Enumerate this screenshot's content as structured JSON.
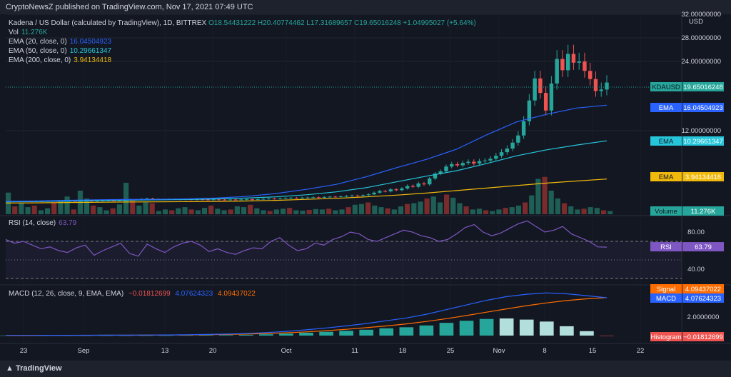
{
  "header": {
    "text": "CryptoNewsZ published on TradingView.com, Nov 17, 2021 07:49 UTC"
  },
  "footer": {
    "brand": "TradingView"
  },
  "legend": {
    "symbol": "Kadena / US Dollar (calculated by TradingView), 1D, BITTREX",
    "ohlc": "O18.54431222  H20.40774462  L17.31689657  C19.65016248  +1.04995027 (+5.64%)",
    "vol_label": "Vol",
    "vol_value": "11.276K",
    "ema20_label": "EMA (20, close, 0)",
    "ema20_value": "16.04504923",
    "ema50_label": "EMA (50, close, 0)",
    "ema50_value": "10.29661347",
    "ema200_label": "EMA (200, close, 0)",
    "ema200_value": "3.94134418",
    "rsi_label": "RSI (14, close)",
    "rsi_value": "63.79",
    "macd_label": "MACD (12, 26, close, 9, EMA, EMA)",
    "macd_hist": "−0.01812699",
    "macd_macd": "4.07624323",
    "macd_signal": "4.09437022"
  },
  "colors": {
    "up": "#26a69a",
    "down": "#ef5350",
    "ema20": "#2962ff",
    "ema50": "#26c6da",
    "ema200": "#f0b90b",
    "rsi": "#7e57c2",
    "macd": "#2962ff",
    "signal": "#ff6d00"
  },
  "chart_data": {
    "type": "candlestick",
    "price_axis": {
      "ticks": [
        "32.00000000",
        "28.00000000",
        "24.00000000",
        "12.00000000"
      ],
      "unit": "USD"
    },
    "rsi_axis": {
      "ticks": [
        "80.00",
        "40.00"
      ]
    },
    "macd_axis": {
      "ticks": [
        "2.0000000"
      ]
    },
    "x_ticks": [
      "23",
      "Sep",
      "13",
      "20",
      "Oct",
      "11",
      "18",
      "25",
      "Nov",
      "8",
      "15",
      "22"
    ],
    "tags": {
      "price": {
        "label": "KDAUSD",
        "value": "19.65016248"
      },
      "ema20": {
        "label": "EMA",
        "value": "16.04504923"
      },
      "ema50": {
        "label": "EMA",
        "value": "10.29661347"
      },
      "ema200": {
        "label": "EMA",
        "value": "3.94134418"
      },
      "volume": {
        "label": "Volume",
        "value": "11.276K"
      },
      "rsi": {
        "label": "RSI",
        "value": "63.79"
      },
      "signal": {
        "label": "Signal",
        "value": "4.09437022"
      },
      "macd": {
        "label": "MACD",
        "value": "4.07624323"
      },
      "histogram": {
        "label": "Histogram",
        "value": "−0.01812699"
      }
    },
    "candles": [
      [
        1.25,
        1.25
      ],
      [
        1.25,
        1.26
      ],
      [
        1.26,
        1.24
      ],
      [
        1.24,
        1.27
      ],
      [
        1.27,
        1.26
      ],
      [
        1.26,
        1.28
      ],
      [
        1.28,
        1.27
      ],
      [
        1.27,
        1.29
      ],
      [
        1.29,
        1.3
      ],
      [
        1.3,
        1.28
      ],
      [
        1.28,
        1.3
      ],
      [
        1.3,
        1.31
      ],
      [
        1.31,
        1.29
      ],
      [
        1.29,
        1.32
      ],
      [
        1.32,
        1.33
      ],
      [
        1.33,
        1.3
      ],
      [
        1.3,
        1.32
      ],
      [
        1.32,
        1.34
      ],
      [
        1.34,
        1.36
      ],
      [
        1.36,
        1.33
      ],
      [
        1.33,
        1.38
      ],
      [
        1.38,
        1.42
      ],
      [
        1.42,
        1.48
      ],
      [
        1.48,
        1.45
      ],
      [
        1.45,
        1.55
      ],
      [
        1.55,
        1.6
      ],
      [
        1.6,
        1.55
      ],
      [
        1.55,
        1.5
      ],
      [
        1.5,
        1.48
      ],
      [
        1.48,
        1.52
      ],
      [
        1.52,
        1.5
      ],
      [
        1.5,
        1.48
      ],
      [
        1.48,
        1.5
      ],
      [
        1.5,
        1.47
      ],
      [
        1.47,
        1.49
      ],
      [
        1.49,
        1.47
      ],
      [
        1.47,
        1.46
      ],
      [
        1.46,
        1.48
      ],
      [
        1.48,
        1.46
      ],
      [
        1.46,
        1.45
      ],
      [
        1.45,
        1.47
      ],
      [
        1.47,
        1.45
      ],
      [
        1.45,
        1.48
      ],
      [
        1.48,
        1.5
      ],
      [
        1.5,
        1.47
      ],
      [
        1.47,
        1.52
      ],
      [
        1.52,
        1.55
      ],
      [
        1.55,
        1.58
      ],
      [
        1.58,
        1.56
      ],
      [
        1.56,
        1.62
      ],
      [
        1.62,
        1.65
      ],
      [
        1.65,
        1.68
      ],
      [
        1.68,
        1.66
      ],
      [
        1.66,
        1.7
      ],
      [
        1.7,
        1.72
      ],
      [
        1.72,
        1.75
      ],
      [
        1.75,
        1.73
      ],
      [
        1.73,
        1.78
      ],
      [
        1.78,
        1.82
      ],
      [
        1.82,
        1.8
      ],
      [
        1.8,
        1.85
      ],
      [
        1.85,
        1.9
      ],
      [
        1.9,
        1.95
      ],
      [
        1.95,
        1.92
      ],
      [
        1.92,
        2.0
      ],
      [
        2.0,
        2.1
      ],
      [
        2.1,
        2.3
      ],
      [
        2.3,
        2.5
      ],
      [
        2.5,
        2.45
      ],
      [
        2.45,
        2.7
      ],
      [
        2.7,
        2.6
      ],
      [
        2.6,
        2.8
      ],
      [
        2.8,
        3.1
      ],
      [
        3.1,
        3.0
      ],
      [
        3.0,
        3.4
      ],
      [
        3.4,
        3.3
      ],
      [
        3.3,
        4.0
      ],
      [
        4.0,
        4.8
      ],
      [
        4.8,
        5.2
      ],
      [
        5.2,
        6.0
      ],
      [
        6.0,
        6.4
      ],
      [
        6.4,
        6.2
      ],
      [
        6.2,
        6.6
      ],
      [
        6.6,
        6.8
      ],
      [
        6.8,
        6.5
      ],
      [
        6.5,
        6.9
      ],
      [
        6.9,
        7.0
      ],
      [
        7.0,
        7.3
      ],
      [
        7.3,
        7.8
      ],
      [
        7.8,
        8.4
      ],
      [
        8.4,
        9.0
      ],
      [
        9.0,
        10.0
      ],
      [
        10.0,
        11.2
      ],
      [
        11.2,
        13.5
      ],
      [
        13.5,
        16.8
      ],
      [
        16.8,
        20.3
      ],
      [
        20.3,
        18.0
      ],
      [
        18.0,
        15.2
      ],
      [
        15.2,
        19.5
      ],
      [
        19.5,
        23.4
      ],
      [
        23.4,
        21.6
      ],
      [
        21.6,
        24.2
      ],
      [
        24.2,
        22.8
      ],
      [
        22.8,
        23.0
      ],
      [
        23.0,
        21.5
      ],
      [
        21.5,
        20.2
      ],
      [
        20.2,
        18.3
      ],
      [
        18.3,
        18.54
      ],
      [
        18.54,
        19.65
      ]
    ],
    "ema20": [
      1.25,
      1.3,
      1.38,
      1.45,
      1.48,
      1.5,
      1.55,
      1.65,
      1.85,
      2.2,
      2.7,
      3.3,
      4.3,
      5.8,
      7.2,
      8.9,
      11.3,
      13.4,
      14.6,
      15.6,
      16.05
    ],
    "ema50": [
      1.2,
      1.25,
      1.3,
      1.35,
      1.4,
      1.44,
      1.48,
      1.55,
      1.65,
      1.8,
      2.05,
      2.4,
      2.9,
      3.6,
      4.4,
      5.3,
      6.5,
      7.8,
      8.8,
      9.6,
      10.3
    ],
    "ema200": [
      1.05,
      1.08,
      1.12,
      1.15,
      1.18,
      1.2,
      1.22,
      1.25,
      1.3,
      1.38,
      1.5,
      1.62,
      1.8,
      2.0,
      2.25,
      2.55,
      2.85,
      3.15,
      3.45,
      3.7,
      3.94
    ],
    "rsi": [
      72,
      68,
      70,
      66,
      62,
      64,
      60,
      58,
      63,
      66,
      55,
      60,
      64,
      68,
      57,
      54,
      67,
      62,
      58,
      64,
      68,
      70,
      66,
      59,
      62,
      58,
      56,
      60,
      63,
      62,
      70,
      74,
      66,
      60,
      62,
      68,
      66,
      72,
      75,
      80,
      78,
      72,
      70,
      74,
      78,
      82,
      80,
      76,
      74,
      70,
      72,
      78,
      85,
      88,
      80,
      76,
      79,
      84,
      89,
      92,
      86,
      80,
      82,
      86,
      78,
      74,
      70,
      64,
      63.79
    ],
    "macd": [
      0.02,
      0.02,
      0.03,
      0.03,
      0.04,
      0.05,
      0.05,
      0.06,
      0.07,
      0.09,
      0.12,
      0.16,
      0.22,
      0.32,
      0.45,
      0.62,
      0.82,
      1.05,
      1.3,
      1.6,
      1.9,
      2.3,
      2.8,
      3.3,
      3.8,
      4.2,
      4.45,
      4.6,
      4.5,
      4.3,
      4.08
    ],
    "signal": [
      0.01,
      0.01,
      0.02,
      0.02,
      0.03,
      0.04,
      0.04,
      0.05,
      0.06,
      0.07,
      0.09,
      0.12,
      0.16,
      0.22,
      0.3,
      0.4,
      0.53,
      0.68,
      0.85,
      1.04,
      1.26,
      1.52,
      1.82,
      2.16,
      2.52,
      2.88,
      3.22,
      3.52,
      3.78,
      3.96,
      4.09
    ],
    "volume": [
      55,
      20,
      30,
      18,
      22,
      10,
      15,
      28,
      34,
      45,
      12,
      60,
      40,
      22,
      18,
      10,
      15,
      25,
      80,
      35,
      22,
      30,
      28,
      8,
      12,
      10,
      15,
      18,
      12,
      10,
      16,
      22,
      14,
      10,
      12,
      20,
      18,
      24,
      15,
      10,
      8,
      12,
      14,
      16,
      10,
      9,
      11,
      13,
      12,
      14,
      10,
      12,
      18,
      24,
      26,
      30,
      22,
      18,
      15,
      12,
      20,
      26,
      28,
      32,
      40,
      45,
      30,
      50,
      42,
      28,
      20,
      12,
      14,
      10,
      8,
      12,
      16,
      18,
      22,
      30,
      48,
      90,
      95,
      60,
      40,
      28,
      20,
      12,
      14,
      18,
      16,
      10,
      8
    ]
  }
}
